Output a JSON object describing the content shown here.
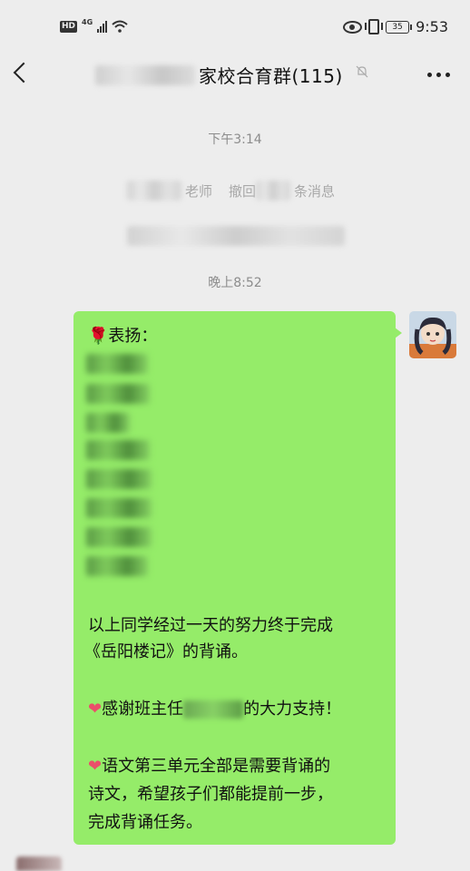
{
  "status_bar": {
    "hd_label": "HD",
    "network": "4G",
    "battery": "35",
    "time": "9:53"
  },
  "nav": {
    "title": "家校合育群(115)",
    "back_icon": "chevron-left-icon",
    "mute_icon": "bell-muted-icon",
    "more_icon": "more-dots-icon"
  },
  "chat": {
    "time_1": "下午3:14",
    "system_fragment_1": "老师",
    "system_fragment_2": "撤回",
    "system_fragment_3": "条消息",
    "time_2": "晚上8:52",
    "message": {
      "header": "表扬：",
      "header_icon": "rose",
      "body_1": "以上同学经过一天的努力终于完成",
      "body_2": "《岳阳楼记》的背诵。",
      "thanks_prefix": "感谢班主任",
      "thanks_suffix": "的大力支持！",
      "note_1": "语文第三单元全部是需要背诵的",
      "note_2": "诗文，希望孩子们都能提前一步，",
      "note_3": "完成背诵任务。",
      "heart_icon": "heart"
    }
  },
  "colors": {
    "background": "#ededed",
    "bubble": "#95ec69",
    "heart": "#ea4f6a"
  }
}
